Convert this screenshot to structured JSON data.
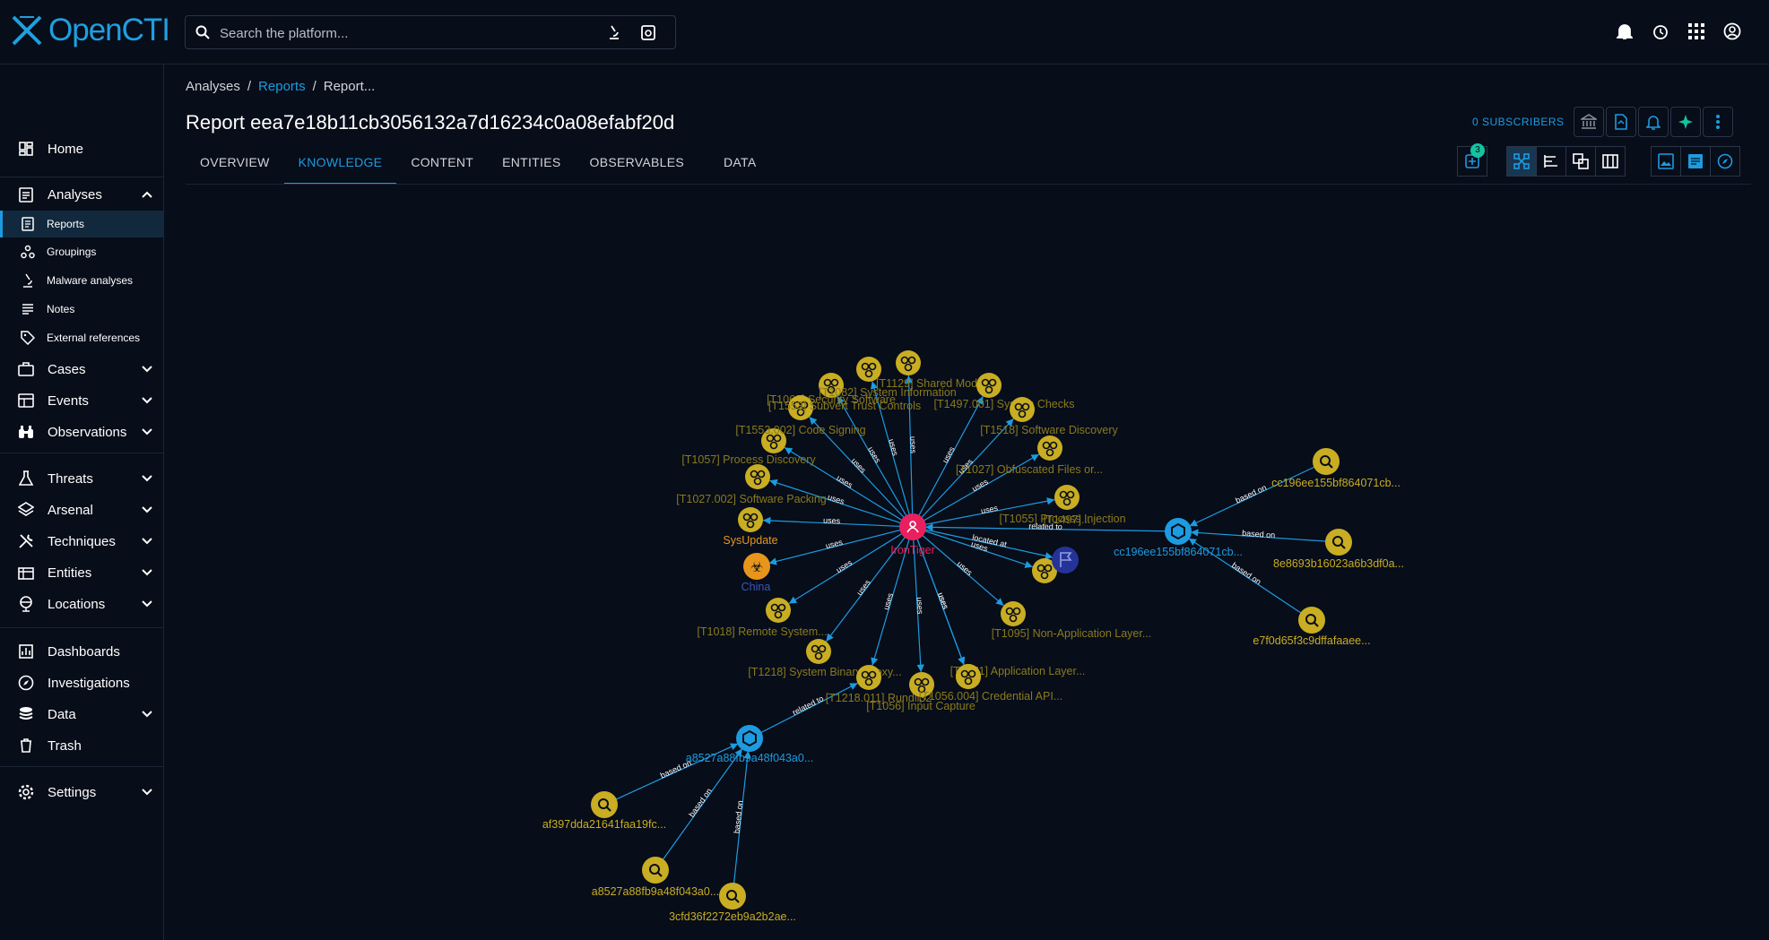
{
  "app": {
    "name": "OpenCTI"
  },
  "search": {
    "placeholder": "Search the platform..."
  },
  "sidebar": {
    "items": [
      {
        "label": "Home"
      },
      {
        "label": "Analyses"
      },
      {
        "label": "Reports"
      },
      {
        "label": "Groupings"
      },
      {
        "label": "Malware analyses"
      },
      {
        "label": "Notes"
      },
      {
        "label": "External references"
      },
      {
        "label": "Cases"
      },
      {
        "label": "Events"
      },
      {
        "label": "Observations"
      },
      {
        "label": "Threats"
      },
      {
        "label": "Arsenal"
      },
      {
        "label": "Techniques"
      },
      {
        "label": "Entities"
      },
      {
        "label": "Locations"
      },
      {
        "label": "Dashboards"
      },
      {
        "label": "Investigations"
      },
      {
        "label": "Data"
      },
      {
        "label": "Trash"
      },
      {
        "label": "Settings"
      }
    ]
  },
  "breadcrumb": {
    "root": "Analyses",
    "section": "Reports",
    "current": "Report..."
  },
  "page": {
    "title": "Report eea7e18b11cb3056132a7d16234c0a08efabf20d",
    "subscribers": "0 SUBSCRIBERS"
  },
  "tabs": [
    "OVERVIEW",
    "KNOWLEDGE",
    "CONTENT",
    "ENTITIES",
    "OBSERVABLES",
    "DATA"
  ],
  "toolbar": {
    "badge_count": "3"
  },
  "colors": {
    "accent": "#1d9be0",
    "attack_pattern": "#c9ad22",
    "intrusion_set": "#e8205f",
    "malware": "#e8951c",
    "observable": "#1d9be0",
    "country": "#253399"
  },
  "graph": {
    "nodes": [
      {
        "label": "IronTiger",
        "type": "intrusion-set"
      },
      {
        "label": "[T1063] Security Software",
        "type": "attack-pattern"
      },
      {
        "label": "[T1129] Shared Modules",
        "type": "attack-pattern"
      },
      {
        "label": "[T1082] System Information",
        "type": "attack-pattern"
      },
      {
        "label": "[T1553] Subvert Trust Controls",
        "type": "attack-pattern"
      },
      {
        "label": "[T1497.001] System Checks",
        "type": "attack-pattern"
      },
      {
        "label": "[T1518] Software Discovery",
        "type": "attack-pattern"
      },
      {
        "label": "[T1553.002] Code Signing",
        "type": "attack-pattern"
      },
      {
        "label": "[T1027] Obfuscated Files or...",
        "type": "attack-pattern"
      },
      {
        "label": "[T1057] Process Discovery",
        "type": "attack-pattern"
      },
      {
        "label": "[T1497]...",
        "type": "attack-pattern"
      },
      {
        "label": "[T1027.002] Software Packing",
        "type": "attack-pattern"
      },
      {
        "label": "[T1055] Process Injection",
        "type": "attack-pattern"
      },
      {
        "label": "SysUpdate",
        "type": "malware"
      },
      {
        "label": "China",
        "type": "country"
      },
      {
        "label": "[T1018] Remote System...",
        "type": "attack-pattern"
      },
      {
        "label": "[T1095] Non-Application Layer...",
        "type": "attack-pattern"
      },
      {
        "label": "[T1218] System Binary Proxy...",
        "type": "attack-pattern"
      },
      {
        "label": "[T1071] Application Layer...",
        "type": "attack-pattern"
      },
      {
        "label": "[T1218.011] Rundll32",
        "type": "attack-pattern"
      },
      {
        "label": "[T1056] Input Capture",
        "type": "attack-pattern"
      },
      {
        "label": "[T1056.004] Credential API...",
        "type": "attack-pattern"
      },
      {
        "label": "a8527a88fb9a48f043a0...",
        "type": "observable"
      },
      {
        "label": "cc196ee155bf864071cb...",
        "type": "observable"
      },
      {
        "label": "cc196ee155bf864071cb...",
        "type": "indicator"
      },
      {
        "label": "8e8693b16023a6b3df0a...",
        "type": "indicator"
      },
      {
        "label": "e7f0d65f3c9dffafaaee...",
        "type": "indicator"
      },
      {
        "label": "af397dda21641faa19fc...",
        "type": "indicator"
      },
      {
        "label": "a8527a88fb9a48f043a0...",
        "type": "indicator"
      },
      {
        "label": "3cfd36f2272eb9a2b2ae...",
        "type": "indicator"
      }
    ],
    "edge_labels": {
      "uses": "uses",
      "located_at": "located at",
      "related_to": "related to",
      "based_on": "based on"
    }
  }
}
